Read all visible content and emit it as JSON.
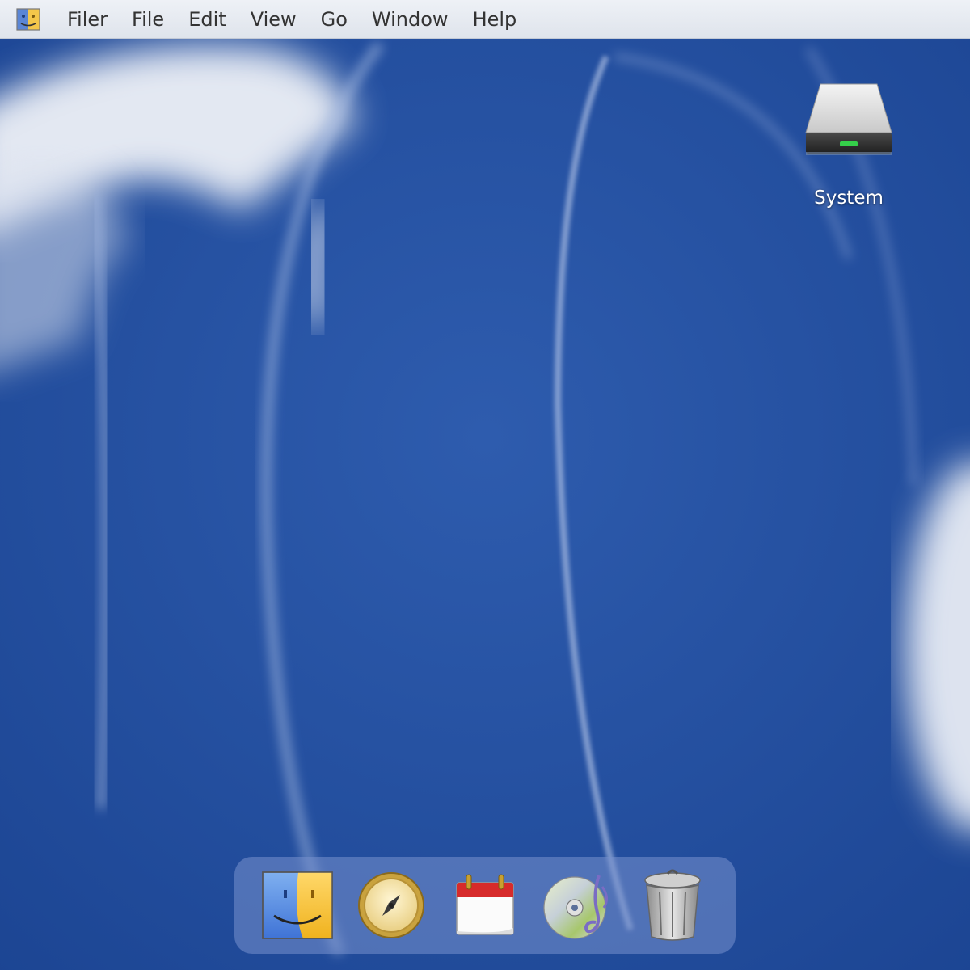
{
  "menubar": {
    "logo_icon": "finder-logo-icon",
    "items": [
      "Filer",
      "File",
      "Edit",
      "View",
      "Go",
      "Window",
      "Help"
    ]
  },
  "desktop": {
    "icons": [
      {
        "label": "System",
        "icon": "hard-drive-icon"
      }
    ]
  },
  "dock": {
    "items": [
      {
        "name": "finder",
        "icon": "finder-icon"
      },
      {
        "name": "safari",
        "icon": "compass-icon"
      },
      {
        "name": "calendar",
        "icon": "calendar-icon"
      },
      {
        "name": "music",
        "icon": "music-cd-icon"
      },
      {
        "name": "trash",
        "icon": "trash-icon"
      }
    ]
  },
  "colors": {
    "desktop_bg": "#234f9e",
    "menubar_bg": "#e6eaf1",
    "dock_bg": "#7891cd"
  }
}
